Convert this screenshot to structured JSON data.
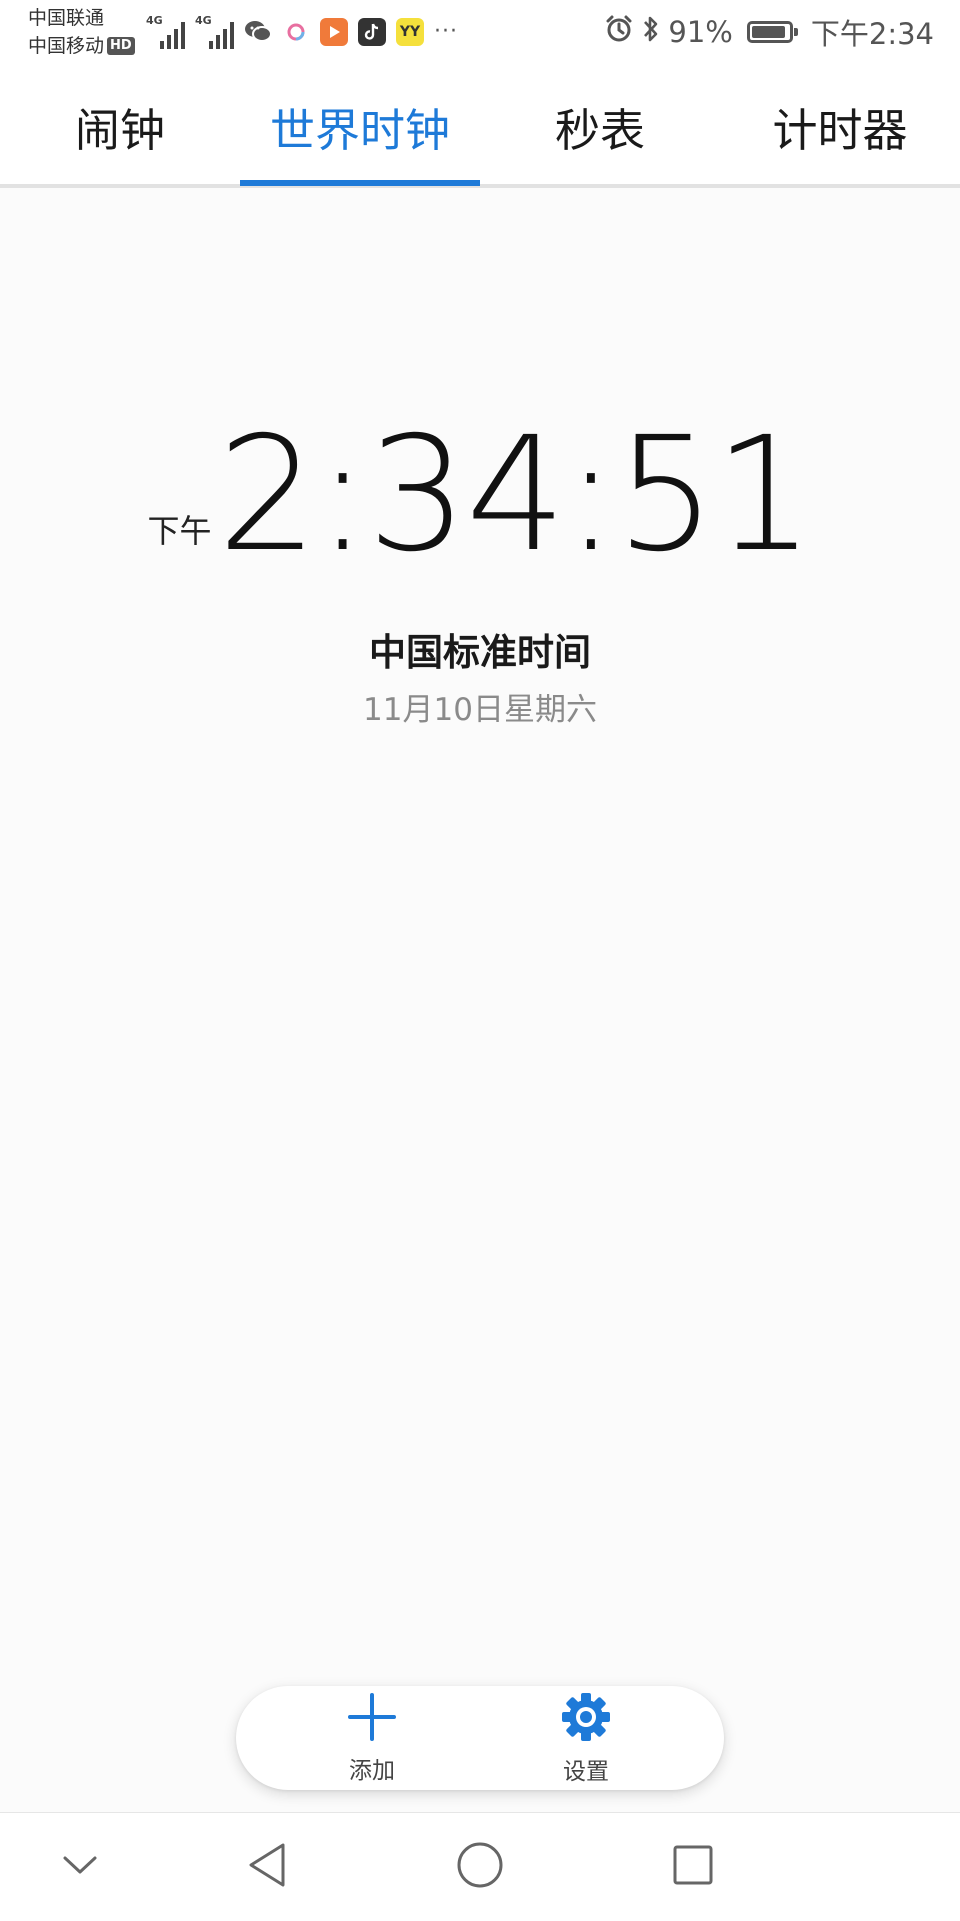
{
  "status_bar": {
    "carrier_1": "中国联通",
    "carrier_2": "中国移动",
    "hd_label": "HD",
    "signal_1_label": "4G",
    "signal_2_label": "4G",
    "yy_label": "YY",
    "more_dots": "···",
    "battery_percent": "91%",
    "battery_level": 0.91,
    "time": "下午2:34",
    "icons": [
      "wechat-icon",
      "app-ring-icon",
      "video-app-icon",
      "tiktok-icon",
      "yy-app-icon",
      "alarm-icon",
      "bluetooth-icon",
      "battery-icon"
    ]
  },
  "tabs": [
    {
      "label": "闹钟"
    },
    {
      "label": "世界时钟"
    },
    {
      "label": "秒表"
    },
    {
      "label": "计时器"
    }
  ],
  "active_tab_index": 1,
  "clock": {
    "ampm": "下午",
    "time": "2:34:51",
    "timezone": "中国标准时间",
    "date": "11月10日星期六"
  },
  "actions": {
    "add_label": "添加",
    "settings_label": "设置"
  },
  "colors": {
    "accent": "#1e7ad8",
    "text": "#111111",
    "muted": "#8a8a8a"
  },
  "nav_icons": [
    "chevron-down-icon",
    "back-icon",
    "home-icon",
    "recents-icon"
  ]
}
